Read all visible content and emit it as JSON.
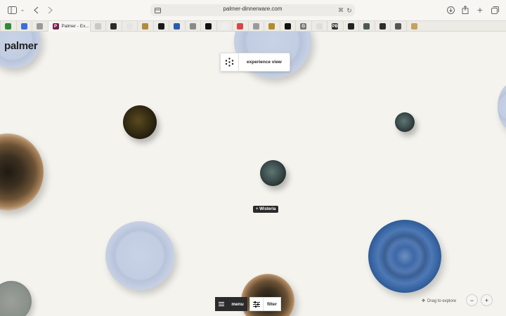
{
  "browser": {
    "url": "palmer-dinnerware.com",
    "active_tab_title": "Palmer - Ex...",
    "icons": [
      "sidebar-icon",
      "chevron-down-icon",
      "back-icon",
      "forward-icon",
      "page-icon",
      "translate-icon",
      "reload-icon",
      "download-icon",
      "share-icon",
      "new-tab-icon",
      "tabs-overview-icon"
    ],
    "favicon_colors": [
      "#2e8b3a",
      "#3a6fd8",
      "#9a9a9a",
      "#7a1f4d",
      "#c9c9c9",
      "#2b2b2b",
      "#e5e5e5",
      "#b48a3c",
      "#1a1a1a",
      "#2a5db0",
      "#8a8a8a",
      "#111111",
      "#eeeeee",
      "#d9464a",
      "#9a9a9a",
      "#b58b2c",
      "#111111",
      "#777777",
      "#dddddd",
      "#333333",
      "#222222",
      "#4b5a52",
      "#2d2d2d",
      "#555555",
      "#c8a060"
    ],
    "favicon_glyphs": [
      "",
      "",
      "",
      "P",
      "",
      "",
      "",
      "",
      "",
      "",
      "",
      "",
      "",
      "",
      "",
      "",
      "",
      "G",
      "",
      "PB",
      "",
      "",
      "",
      "",
      ""
    ]
  },
  "page": {
    "logo": "palmer",
    "experience_view": "experience view",
    "wisteria_tag": "+ Wisteria",
    "menu": "menu",
    "filter": "filter",
    "drag_hint": "Drag to explore",
    "zoom_out": "−",
    "zoom_in": "+"
  },
  "colors": {
    "background": "#f4f3ee",
    "dark_button": "#2b2b2b"
  }
}
